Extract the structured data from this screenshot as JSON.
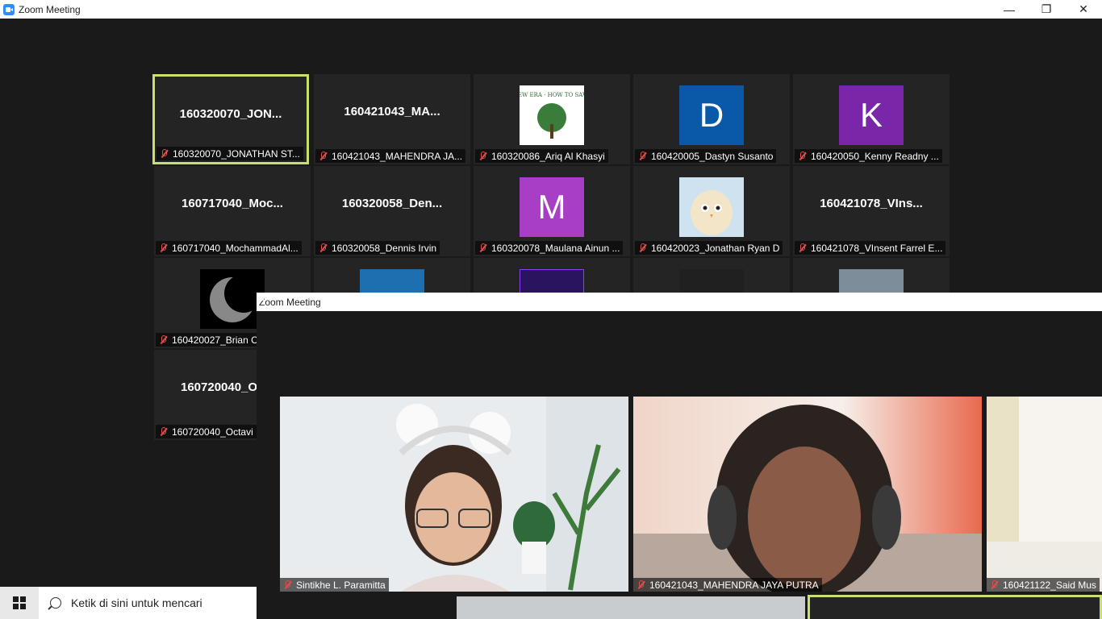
{
  "window": {
    "title": "Zoom Meeting",
    "minimize": "—",
    "maximize": "❐",
    "close": "✕"
  },
  "gallery": [
    {
      "big": "160320070_JON...",
      "name": "160320070_JONATHAN ST...",
      "active": true
    },
    {
      "big": "160421043_MA...",
      "name": "160421043_MAHENDRA JA..."
    },
    {
      "avatar": "logo",
      "avatar_text": "NEW ERA · HOW TO SAVE",
      "name": "160320086_Ariq Al Khasyi"
    },
    {
      "avatar": "letter",
      "letter": "D",
      "color": "#0a58a8",
      "name": "160420005_Dastyn Susanto"
    },
    {
      "avatar": "letter",
      "letter": "K",
      "color": "#7a26a8",
      "name": "160420050_Kenny Readny ..."
    },
    {
      "big": "160717040_Moc...",
      "name": "160717040_MochammadAl..."
    },
    {
      "big": "160320058_Den...",
      "name": "160320058_Dennis Irvin"
    },
    {
      "avatar": "letter",
      "letter": "M",
      "color": "#a83ec4",
      "name": "160320078_Maulana Ainun ..."
    },
    {
      "avatar": "bird",
      "name": "160420023_Jonathan Ryan D"
    },
    {
      "big": "160421078_VIns...",
      "name": "160421078_VInsent Farrel E..."
    },
    {
      "avatar": "moon",
      "name": "160420027_Brian C"
    },
    {
      "avatar": "photo",
      "name": ""
    },
    {
      "avatar": "neon",
      "name": ""
    },
    {
      "avatar": "dark",
      "name": ""
    },
    {
      "avatar": "grey",
      "name": ""
    },
    {
      "big": "160720040_O",
      "name": "160720040_Octavi"
    }
  ],
  "overlay": {
    "title": "Zoom Meeting",
    "videos": [
      {
        "name": "Sintikhe L. Paramitta"
      },
      {
        "name": "160421043_MAHENDRA JAYA PUTRA"
      },
      {
        "name": "160421122_Said Mus"
      }
    ]
  },
  "taskbar": {
    "search_placeholder": "Ketik di sini untuk mencari"
  }
}
